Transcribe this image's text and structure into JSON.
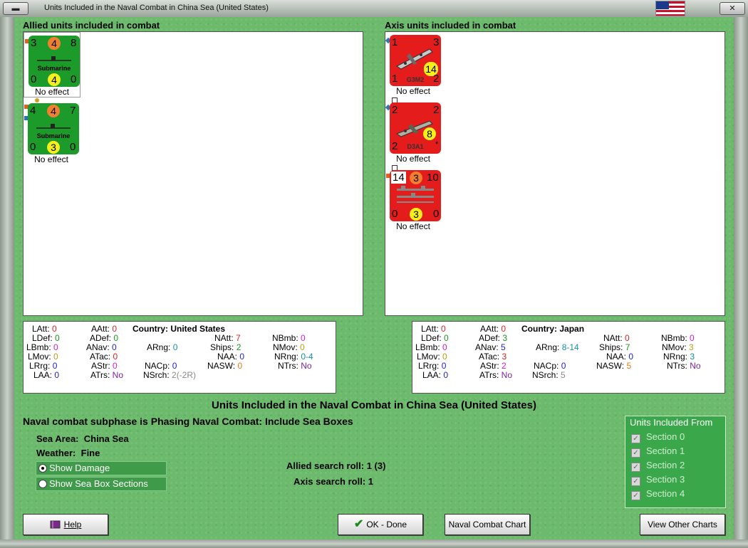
{
  "window": {
    "title": "Units Included in the Naval Combat in China Sea (United States)",
    "minimize_label": "▬",
    "close_label": "✕",
    "colors": {
      "felt": "#6cba6c",
      "allied_counter": "#1c9a2a",
      "axis_counter": "#e51c1c"
    }
  },
  "allied": {
    "header": "Allied units included in combat",
    "units": [
      {
        "tl": "3",
        "tc": "4",
        "tr": "8",
        "name": "Submarine",
        "bl": "0",
        "bc": "4",
        "br": "0",
        "effect": "No effect"
      },
      {
        "tl": "4",
        "tc": "4",
        "tr": "7",
        "name": "Submarine",
        "bl": "0",
        "bc": "3",
        "br": "0",
        "effect": "No effect"
      }
    ],
    "stats": {
      "LAtt": "0",
      "LDef": "0",
      "LBmb": "0",
      "LMov": "0",
      "LRrg": "0",
      "LAA": "0",
      "AAtt": "0",
      "ADef": "0",
      "ANav": "0",
      "ATac": "0",
      "AStr": "0",
      "ATrs": "No",
      "country_label": "Country:",
      "country": "United States",
      "ARng": "0",
      "NACp": "0",
      "NSrch": "2(-2R)",
      "NAtt": "7",
      "Ships": "2",
      "NAA": "0",
      "NASW": "0",
      "NBmb": "0",
      "NMov": "0",
      "NRng": "0-4",
      "NTrs": "No"
    }
  },
  "axis": {
    "header": "Axis units included in combat",
    "units": [
      {
        "tl": "1",
        "tr": "3",
        "mid": "14",
        "name": "G3M2",
        "bl": "1",
        "br": "2",
        "effect": "No effect"
      },
      {
        "tl": "2",
        "tr": "2",
        "mid": "8",
        "name": "D3A1",
        "bl": "2",
        "br": "*",
        "effect": "No effect"
      },
      {
        "tl": "14",
        "tc": "3",
        "tr": "10",
        "bl": "0",
        "bc": "3",
        "br": "0",
        "effect": "No effect"
      }
    ],
    "stats": {
      "LAtt": "0",
      "LDef": "0",
      "LBmb": "0",
      "LMov": "0",
      "LRrg": "0",
      "LAA": "0",
      "AAtt": "0",
      "ADef": "3",
      "ANav": "5",
      "ATac": "3",
      "AStr": "2",
      "ATrs": "No",
      "country_label": "Country:",
      "country": "Japan",
      "ARng": "8-14",
      "NACp": "0",
      "NSrch": "5",
      "NAtt": "0",
      "Ships": "7",
      "NAA": "0",
      "NASW": "5",
      "NBmb": "0",
      "NMov": "3",
      "NRng": "3",
      "NTrs": "No"
    }
  },
  "summary": {
    "title": "Units Included in the Naval Combat in China Sea (United States)",
    "subphase": "Naval combat subphase is Phasing Naval Combat: Include Sea Boxes",
    "sea_area_label": "Sea Area:",
    "sea_area": "China Sea",
    "weather_label": "Weather:",
    "weather": "Fine",
    "show_damage": "Show Damage",
    "show_sections": "Show Sea Box Sections",
    "allied_search_label": "Allied search roll:",
    "allied_search": "1 (3)",
    "axis_search_label": "Axis search roll:",
    "axis_search": "1"
  },
  "sections": {
    "title": "Units Included From",
    "items": [
      "Section 0",
      "Section 1",
      "Section 2",
      "Section 3",
      "Section 4"
    ]
  },
  "buttons": {
    "help": "Help",
    "ok": "OK - Done",
    "naval_chart": "Naval Combat Chart",
    "other_charts": "View Other Charts"
  },
  "icons": {
    "help": "book-icon",
    "ok": "checkmark-icon",
    "flag": "us-flag-icon"
  }
}
